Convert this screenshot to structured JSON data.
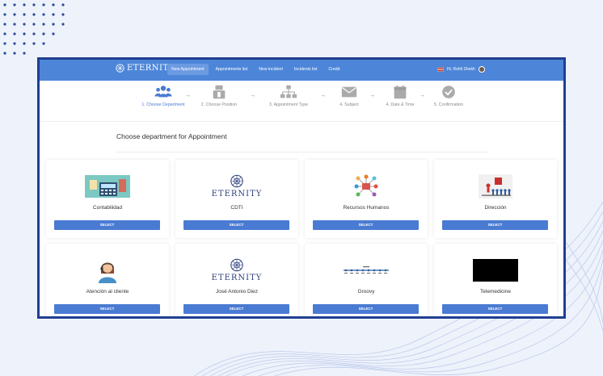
{
  "navbar": {
    "brand": "ETERNITY",
    "items": [
      {
        "label": "New Appointment",
        "active": true
      },
      {
        "label": "Appointments list",
        "active": false
      },
      {
        "label": "New incident",
        "active": false
      },
      {
        "label": "Incidents list",
        "active": false
      },
      {
        "label": "Credit",
        "active": false
      }
    ],
    "user": "Hi, Rohit Shekh",
    "colors": {
      "bar": "#4d86d9",
      "active": "#6d9be2"
    }
  },
  "steps": [
    {
      "label": "1. Choose Department",
      "icon": "users-icon",
      "active": true
    },
    {
      "label": "2. Choose Position",
      "icon": "position-icon",
      "active": false
    },
    {
      "label": "3. Appointment Type",
      "icon": "sitemap-icon",
      "active": false
    },
    {
      "label": "4. Subject",
      "icon": "envelope-icon",
      "active": false
    },
    {
      "label": "4. Date & Time",
      "icon": "calendar-icon",
      "active": false
    },
    {
      "label": "5. Confirmation",
      "icon": "check-circle-icon",
      "active": false
    }
  ],
  "section_title": "Choose department for Appointment",
  "departments": [
    {
      "name": "Contabilidad",
      "image": "accounting-image",
      "button": "SELECT"
    },
    {
      "name": "CDTI",
      "image": "eternity-logo",
      "logo_text": "ETERNITY",
      "button": "SELECT"
    },
    {
      "name": "Recursos Humanos",
      "image": "hr-network-image",
      "button": "SELECT"
    },
    {
      "name": "Dirección",
      "image": "leadership-image",
      "button": "SELECT"
    },
    {
      "name": "Atención al cliente",
      "image": "support-agent-image",
      "button": "SELECT"
    },
    {
      "name": "José Antonio Diez",
      "image": "eternity-logo",
      "logo_text": "ETERNITY",
      "button": "SELECT"
    },
    {
      "name": "Groovy",
      "image": "timeline-image",
      "button": "SELECT"
    },
    {
      "name": "Telemedicine",
      "image": "black-image",
      "button": "SELECT"
    }
  ],
  "colors": {
    "accent": "#4a7bd3",
    "frame_border": "#1f3f92",
    "background": "#eef2fb"
  }
}
